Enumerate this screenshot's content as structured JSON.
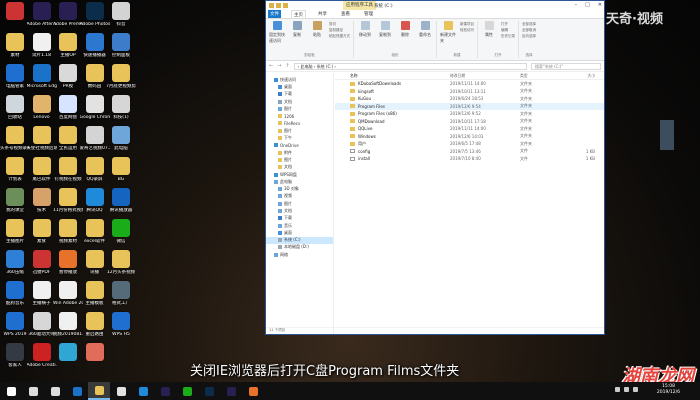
{
  "desktop_icons": [
    {
      "label": "",
      "color": "#cc3333"
    },
    {
      "label": "Adobe After Effects CC...",
      "color": "#2a1f52"
    },
    {
      "label": "Adobe Premiere P...",
      "color": "#2a1f52"
    },
    {
      "label": "Adobe Photosh...",
      "color": "#0b2c4a"
    },
    {
      "label": "抖音",
      "color": "#d3d3d3"
    },
    {
      "label": "素材",
      "color": "#e8c35a"
    },
    {
      "label": "试片1.18",
      "color": "#f0f0f0"
    },
    {
      "label": "主播OP",
      "color": "#e8c35a"
    },
    {
      "label": "快速播播器",
      "color": "#2c77d0"
    },
    {
      "label": "控制面板",
      "color": "#3d7cc9"
    },
    {
      "label": "电脑管家",
      "color": "#1f6fd1"
    },
    {
      "label": "Microsoft Edge",
      "color": "#1b73c9"
    },
    {
      "label": "PR视",
      "color": "#d9d9d9"
    },
    {
      "label": "数码园",
      "color": "#e8c35a"
    },
    {
      "label": "7月底更视频剪辑",
      "color": "#e8c35a"
    },
    {
      "label": "回收站",
      "color": "#cfd6dc"
    },
    {
      "label": "Lenovo",
      "color": "#e2b36a"
    },
    {
      "label": "百度网盘",
      "color": "#d6e4ff"
    },
    {
      "label": "Google Chrome",
      "color": "#e2e2e2"
    },
    {
      "label": "科技(1)",
      "color": "#d6d6d6"
    },
    {
      "label": "头条号视频录制",
      "color": "#e8c35a"
    },
    {
      "label": "天使社视频后期制作",
      "color": "#e8c35a"
    },
    {
      "label": "全民运用",
      "color": "#e8c35a"
    },
    {
      "label": "爱奇艺视频07.29...",
      "color": "#d4d4d4"
    },
    {
      "label": "此电脑",
      "color": "#6fa6d9"
    },
    {
      "label": "计划表",
      "color": "#e8c35a"
    },
    {
      "label": "尾巴软件",
      "color": "#e8c35a"
    },
    {
      "label": "钉视频在视频",
      "color": "#e8c35a"
    },
    {
      "label": "QQ录屏",
      "color": "#e8c35a"
    },
    {
      "label": "BG",
      "color": "#e8c35a"
    },
    {
      "label": "我的课堂",
      "color": "#6c8e5a"
    },
    {
      "label": "技术",
      "color": "#d6a26a"
    },
    {
      "label": "11月份格式视频",
      "color": "#e8c35a"
    },
    {
      "label": "腾讯QQ",
      "color": "#1f8ad9"
    },
    {
      "label": "腾讯播放器",
      "color": "#1565c0"
    },
    {
      "label": "主播图片",
      "color": "#e8c35a"
    },
    {
      "label": "素食",
      "color": "#e8c35a"
    },
    {
      "label": "视频素材",
      "color": "#e8c35a"
    },
    {
      "label": "excel软件",
      "color": "#e8c35a"
    },
    {
      "label": "微信",
      "color": "#1aad19"
    },
    {
      "label": "360压缩",
      "color": "#2e7fd6"
    },
    {
      "label": "迅捷PDF",
      "color": "#cc3333"
    },
    {
      "label": "暂停播放",
      "color": "#e8722a"
    },
    {
      "label": "讯播",
      "color": "#e8c35a"
    },
    {
      "label": "12月头条视频",
      "color": "#e8c35a"
    },
    {
      "label": "酷狗音乐",
      "color": "#1f6fd1"
    },
    {
      "label": "主播横子",
      "color": "#f0f0f0"
    },
    {
      "label": "Win Adobe 2018 注册",
      "color": "#f0f0f0"
    },
    {
      "label": "主播模板",
      "color": "#e8c35a"
    },
    {
      "label": "格式工厂",
      "color": "#556b7a"
    },
    {
      "label": "WPS 2019",
      "color": "#1f6fd1"
    },
    {
      "label": "360驱动大师",
      "color": "#d7d7d7"
    },
    {
      "label": "视频2019081...",
      "color": "#f0f0f0"
    },
    {
      "label": "重启路由",
      "color": "#e8c35a"
    },
    {
      "label": "WPS H5",
      "color": "#1f6fd1"
    },
    {
      "label": "客家人",
      "color": "#333a44"
    },
    {
      "label": "Adobe Creati...",
      "color": "#cc2222"
    },
    {
      "label": "",
      "color": "#30a6d5"
    },
    {
      "label": "",
      "color": "#e06c5a"
    }
  ],
  "explorer": {
    "context_tab": "应用程序工具",
    "title": "系统 (C:)",
    "window_buttons": [
      "–",
      "□",
      "✕"
    ],
    "tabs": [
      "文件",
      "主页",
      "共享",
      "查看",
      "管理"
    ],
    "ribbon": {
      "pin_label": "固定到快速访问",
      "copy_label": "复制",
      "paste_label": "粘贴",
      "cut_label": "剪切",
      "copy_path_label": "复制路径",
      "paste_shortcut_label": "粘贴快捷方式",
      "clipboard_group": "剪贴板",
      "move_to_label": "移动到",
      "copy_to_label": "复制到",
      "delete_label": "删除",
      "rename_label": "重命名",
      "organize_group": "组织",
      "new_folder_label": "新建文件夹",
      "new_item_label": "新建项目",
      "easy_access_label": "轻松访问",
      "new_group": "新建",
      "properties_label": "属性",
      "open_label": "打开",
      "edit_label": "编辑",
      "history_label": "历史记录",
      "open_group": "打开",
      "select_all_label": "全部选择",
      "select_none_label": "全部取消",
      "invert_label": "反向选择",
      "select_group": "选择"
    },
    "address": "› 此电脑 › 系统 (C:) ›",
    "search_placeholder": "搜索\"系统 (C:)\"",
    "nav_back": "←",
    "nav_forward": "→",
    "nav_up": "↑",
    "nav_items": [
      {
        "label": "快速访问",
        "level": 1,
        "color": "#3b8fd9"
      },
      {
        "label": "桌面",
        "level": 2,
        "color": "#4a90d9"
      },
      {
        "label": "下载",
        "level": 2,
        "color": "#3b7fc4"
      },
      {
        "label": "文档",
        "level": 2,
        "color": "#8aa4bf"
      },
      {
        "label": "图片",
        "level": 2,
        "color": "#6ba8d9"
      },
      {
        "label": "1206",
        "level": 2,
        "color": "#e8c35a"
      },
      {
        "label": "FileRecv",
        "level": 2,
        "color": "#e8c35a"
      },
      {
        "label": "图片",
        "level": 2,
        "color": "#e8c35a"
      },
      {
        "label": "下午",
        "level": 2,
        "color": "#e8c35a"
      },
      {
        "label": "OneDrive",
        "level": 1,
        "color": "#3b8fd9"
      },
      {
        "label": "附件",
        "level": 2,
        "color": "#e8c35a"
      },
      {
        "label": "图片",
        "level": 2,
        "color": "#e8c35a"
      },
      {
        "label": "文档",
        "level": 2,
        "color": "#e8c35a"
      },
      {
        "label": "WPS网盘",
        "level": 1,
        "color": "#3b8fd9"
      },
      {
        "label": "此电脑",
        "level": 1,
        "color": "#6fa6d9"
      },
      {
        "label": "3D 对象",
        "level": 2,
        "color": "#6fa6d9"
      },
      {
        "label": "视频",
        "level": 2,
        "color": "#6fa6d9"
      },
      {
        "label": "图片",
        "level": 2,
        "color": "#6fa6d9"
      },
      {
        "label": "文档",
        "level": 2,
        "color": "#6fa6d9"
      },
      {
        "label": "下载",
        "level": 2,
        "color": "#3b7fc4"
      },
      {
        "label": "音乐",
        "level": 2,
        "color": "#6fa6d9"
      },
      {
        "label": "桌面",
        "level": 2,
        "color": "#4a90d9"
      },
      {
        "label": "系统 (C:)",
        "level": 2,
        "color": "#9aa6b2",
        "selected": true
      },
      {
        "label": "本地磁盘 (D:)",
        "level": 2,
        "color": "#9aa6b2"
      },
      {
        "label": "网络",
        "level": 1,
        "color": "#6fa6d9"
      }
    ],
    "columns": {
      "name": "名称",
      "date": "修改日期",
      "type": "类型",
      "size": "大小"
    },
    "files": [
      {
        "name": "KDubaSoftDownloads",
        "date": "2019/11/11 14:00",
        "type": "文件夹",
        "size": "",
        "kind": "folder"
      },
      {
        "name": "kingsoft",
        "date": "2019/10/11 13:11",
        "type": "文件夹",
        "size": "",
        "kind": "folder"
      },
      {
        "name": "KuGou",
        "date": "2019/6/24 18:53",
        "type": "文件夹",
        "size": "",
        "kind": "folder"
      },
      {
        "name": "Program Files",
        "date": "2019/12/6 9:54",
        "type": "文件夹",
        "size": "",
        "kind": "folder",
        "selected": true
      },
      {
        "name": "Program Files (x86)",
        "date": "2019/12/6 9:52",
        "type": "文件夹",
        "size": "",
        "kind": "folder"
      },
      {
        "name": "QMDownload",
        "date": "2019/10/11 17:18",
        "type": "文件夹",
        "size": "",
        "kind": "folder"
      },
      {
        "name": "QQLive",
        "date": "2019/11/11 14:00",
        "type": "文件夹",
        "size": "",
        "kind": "folder"
      },
      {
        "name": "Windows",
        "date": "2019/12/6 14:03",
        "type": "文件夹",
        "size": "",
        "kind": "folder"
      },
      {
        "name": "用户",
        "date": "2019/6/5 17:48",
        "type": "文件夹",
        "size": "",
        "kind": "folder"
      },
      {
        "name": "config",
        "date": "2019/7/5 13:46",
        "type": "文件",
        "size": "1 KB",
        "kind": "file"
      },
      {
        "name": "install",
        "date": "2019/7/10 8:40",
        "type": "文件",
        "size": "1 KB",
        "kind": "file"
      }
    ],
    "status": "11 个项目"
  },
  "subtitle": "关闭IE浏览器后打开C盘Program  Films文件夹",
  "watermark_top": "天奇·视频",
  "watermark_bottom": "湖南龙网",
  "taskbar": {
    "apps": [
      {
        "name": "windows-start-icon",
        "color": "#ffffff"
      },
      {
        "name": "search-icon",
        "color": "#dddddd"
      },
      {
        "name": "task-view-icon",
        "color": "#dddddd"
      },
      {
        "name": "edge-icon",
        "color": "#1b73c9"
      },
      {
        "name": "explorer-icon",
        "color": "#e8c35a",
        "active": true
      },
      {
        "name": "chrome-icon",
        "color": "#e2e2e2"
      },
      {
        "name": "qq-icon",
        "color": "#1f8ad9"
      },
      {
        "name": "premiere-icon",
        "color": "#2a1f52"
      },
      {
        "name": "wechat-icon",
        "color": "#1aad19"
      },
      {
        "name": "photoshop-icon",
        "color": "#0b2c4a"
      },
      {
        "name": "after-effects-icon",
        "color": "#2a1f52"
      },
      {
        "name": "media-icon",
        "color": "#e8722a"
      }
    ],
    "time": "15:08",
    "date": "2019/12/6"
  }
}
